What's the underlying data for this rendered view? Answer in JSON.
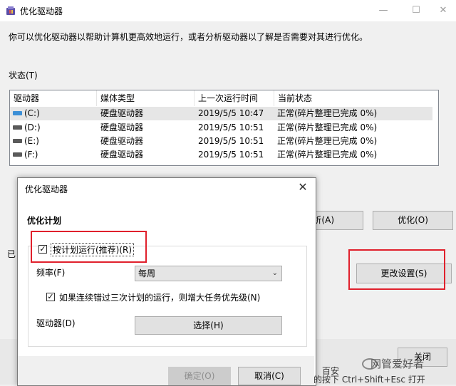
{
  "main": {
    "title": "优化驱动器",
    "description": "你可以优化驱动器以帮助计算机更高效地运行，或者分析驱动器以了解是否需要对其进行优化。",
    "status_label": "状态(T)",
    "columns": [
      "驱动器",
      "媒体类型",
      "上一次运行时间",
      "当前状态"
    ],
    "rows": [
      {
        "drive": "(C:)",
        "media": "硬盘驱动器",
        "last_run": "2019/5/5 10:47",
        "status": "正常(碎片整理已完成 0%)"
      },
      {
        "drive": "(D:)",
        "media": "硬盘驱动器",
        "last_run": "2019/5/5 10:51",
        "status": "正常(碎片整理已完成 0%)"
      },
      {
        "drive": "(E:)",
        "media": "硬盘驱动器",
        "last_run": "2019/5/5 10:51",
        "status": "正常(碎片整理已完成 0%)"
      },
      {
        "drive": "(F:)",
        "media": "硬盘驱动器",
        "last_run": "2019/5/5 10:51",
        "status": "正常(碎片整理已完成 0%)"
      }
    ],
    "analyze_label_partial": "析(A)",
    "optimize_label": "优化(O)",
    "change_settings_label": "更改设置(S)",
    "scheduled_partial": "已",
    "close_label_partial": "关闭"
  },
  "dialog": {
    "title": "优化驱动器",
    "heading": "优化计划",
    "schedule_checkbox_label": "按计划运行(推荐)(R)",
    "frequency_label": "频率(F)",
    "frequency_value": "每周",
    "escalate_checkbox_label": "如果连续错过三次计划的运行，则增大任务优先级(N)",
    "drives_label": "驱动器(D)",
    "choose_label": "选择(H)",
    "ok_label": "确定(O)",
    "cancel_label": "取消(C)"
  },
  "overlay": {
    "stray_text_1": "百安",
    "stray_text_2": "的按下 Ctrl+Shift+Esc 打开",
    "watermark": "网管爱好者"
  }
}
